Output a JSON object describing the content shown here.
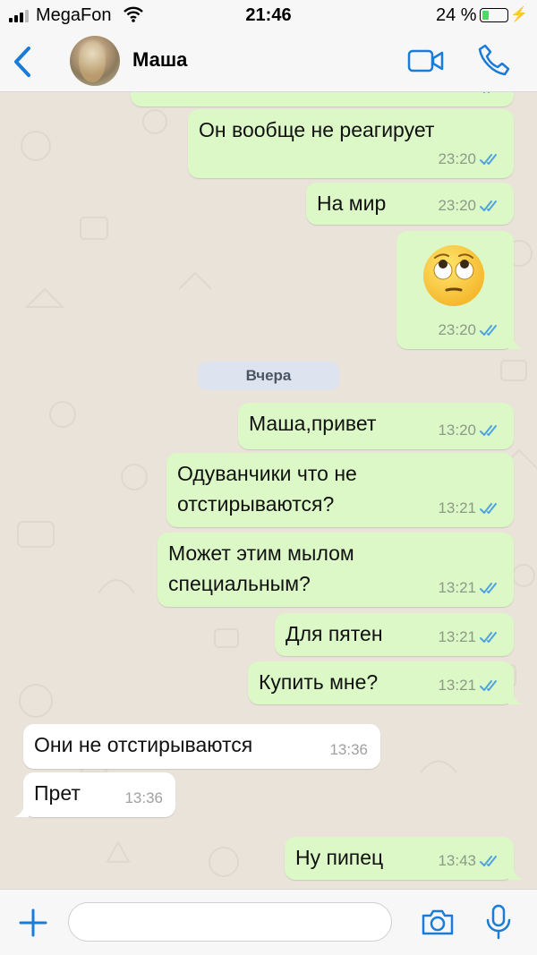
{
  "status": {
    "carrier": "MegaFon",
    "time": "21:46",
    "battery": "24 %"
  },
  "header": {
    "contact_name": "Маша"
  },
  "chat": {
    "date_separator": "Вчера",
    "messages": [
      {
        "dir": "out",
        "text": "",
        "time": "23:20"
      },
      {
        "dir": "out",
        "text": "Он вообще не реагирует",
        "time": "23:20"
      },
      {
        "dir": "out",
        "text": "На мир",
        "time": "23:20"
      },
      {
        "dir": "out",
        "emoji": "face-with-rolling-eyes",
        "time": "23:20"
      },
      {
        "dir": "out",
        "text": "Маша,привет",
        "time": "13:20"
      },
      {
        "dir": "out",
        "text": "Одуванчики что не\nотстирываются?",
        "time": "13:21"
      },
      {
        "dir": "out",
        "text": "Может этим мылом\nспециальным?",
        "time": "13:21"
      },
      {
        "dir": "out",
        "text": "Для пятен",
        "time": "13:21"
      },
      {
        "dir": "out",
        "text": "Купить мне?",
        "time": "13:21"
      },
      {
        "dir": "in",
        "text": "Они не отстирываются",
        "time": "13:36"
      },
      {
        "dir": "in",
        "text": "Прет",
        "time": "13:36"
      },
      {
        "dir": "out",
        "text": "Ну пипец",
        "time": "13:43"
      }
    ]
  },
  "input": {
    "placeholder": ""
  },
  "colors": {
    "accent": "#1a7bd8",
    "outgoing_bubble": "#dcf8c6",
    "incoming_bubble": "#ffffff",
    "read_ticks": "#4fa3e0"
  }
}
